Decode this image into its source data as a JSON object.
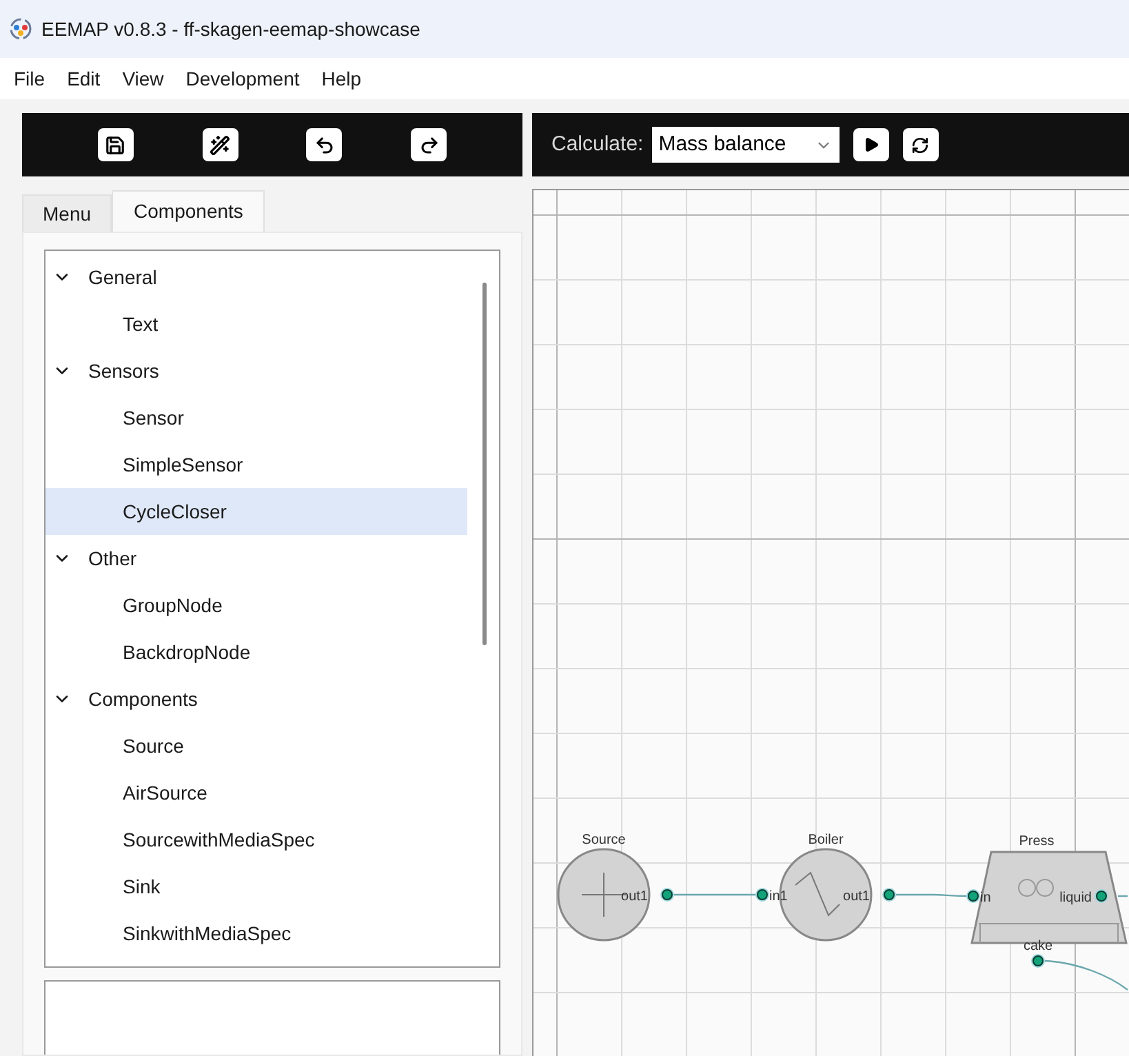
{
  "window": {
    "title": "EEMAP v0.8.3 - ff-skagen-eemap-showcase"
  },
  "menu_bar": [
    "File",
    "Edit",
    "View",
    "Development",
    "Help"
  ],
  "tabs": [
    {
      "label": "Menu",
      "selected": false
    },
    {
      "label": "Components",
      "selected": true
    }
  ],
  "tree": [
    {
      "label": "General",
      "expanded": true,
      "selected": false,
      "children": [
        {
          "label": "Text",
          "selected": false
        }
      ]
    },
    {
      "label": "Sensors",
      "expanded": true,
      "selected": false,
      "children": [
        {
          "label": "Sensor",
          "selected": false
        },
        {
          "label": "SimpleSensor",
          "selected": false
        },
        {
          "label": "CycleCloser",
          "selected": true
        }
      ]
    },
    {
      "label": "Other",
      "expanded": true,
      "selected": false,
      "children": [
        {
          "label": "GroupNode",
          "selected": false
        },
        {
          "label": "BackdropNode",
          "selected": false
        }
      ]
    },
    {
      "label": "Components",
      "expanded": true,
      "selected": false,
      "children": [
        {
          "label": "Source",
          "selected": false
        },
        {
          "label": "AirSource",
          "selected": false
        },
        {
          "label": "SourcewithMediaSpec",
          "selected": false
        },
        {
          "label": "Sink",
          "selected": false
        },
        {
          "label": "SinkwithMediaSpec",
          "selected": false
        }
      ]
    }
  ],
  "calculate": {
    "label": "Calculate:",
    "value": "Mass balance"
  },
  "diagram": {
    "nodes": [
      {
        "kind": "source",
        "title": "Source",
        "ports": [
          "out1"
        ]
      },
      {
        "kind": "boiler",
        "title": "Boiler",
        "ports": [
          "in1",
          "out1"
        ]
      },
      {
        "kind": "press",
        "title": "Press",
        "ports": [
          "in",
          "liquid",
          "cake"
        ]
      }
    ]
  }
}
